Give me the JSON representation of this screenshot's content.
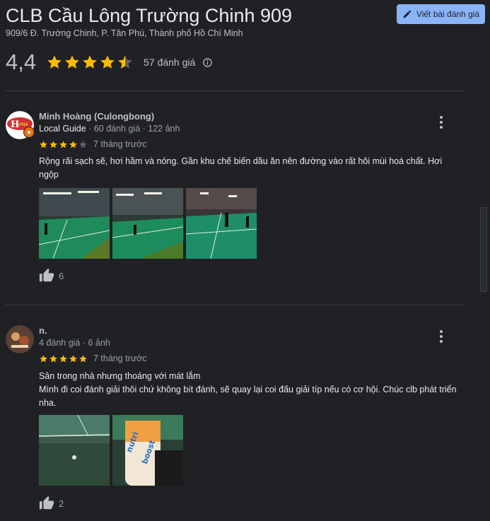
{
  "place": {
    "title": "CLB Cầu Lông Trường Chinh 909",
    "address": "909/6 Đ. Trường Chinh, P. Tân Phú, Thành phố Hồ Chí Minh",
    "rating": "4,4",
    "rating_value": 4.4,
    "review_count": "57 đánh giá"
  },
  "actions": {
    "write_review": "Viết bài đánh giá"
  },
  "colors": {
    "star": "#fbbc04",
    "star_empty": "#5f6368",
    "accent": "#8ab4f8",
    "background": "#202124"
  },
  "reviews": [
    {
      "author": "Minh Hoàng (Culongbong)",
      "local_guide": "Local Guide",
      "stats": " · 60 đánh giá · 122 ảnh",
      "stars": 4,
      "time": "7 tháng trước",
      "text": "Rộng rãi sạch sẽ, hơi hầm và nóng. Gần khu chế biến dầu ăn nên đường vào rất hôi mùi hoá chất. Hơi ngộp",
      "likes": "6"
    },
    {
      "author": "n.",
      "stats": "4 đánh giá · 6 ảnh",
      "stars": 5,
      "time": "7 tháng trước",
      "text": "Sân trong nhà nhưng thoáng với mát lắm\nMình đi coi đánh giải thôi chứ không bít đánh, sẽ quay lại coi đấu giải típ nếu có cơ hội. Chúc clb phát triển nha.",
      "likes": "2"
    }
  ],
  "icons": [
    "pencil-icon",
    "star-icon",
    "info-icon",
    "more-vert-icon",
    "thumb-up-icon",
    "local-guide-star-icon"
  ]
}
